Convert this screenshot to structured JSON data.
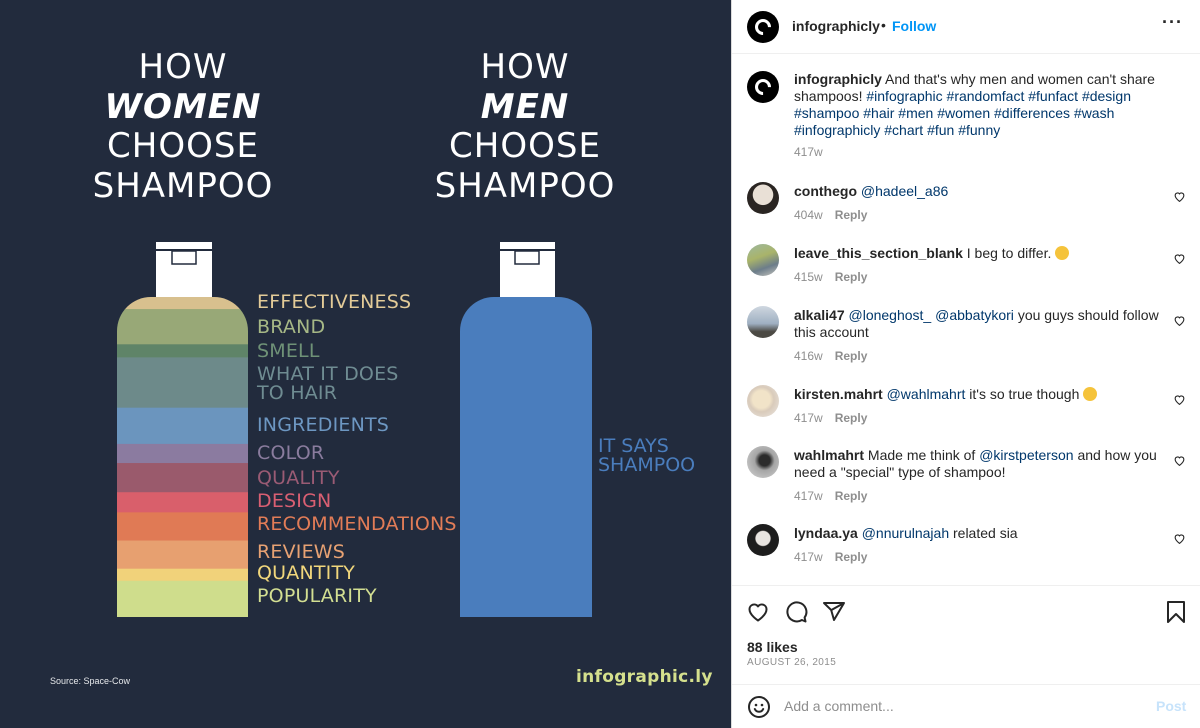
{
  "infographic": {
    "title_women": [
      "HOW",
      "WOMEN",
      "CHOOSE",
      "SHAMPOO"
    ],
    "title_men": [
      "HOW",
      "MEN",
      "CHOOSE",
      "SHAMPOO"
    ],
    "women_factors": [
      {
        "label": "EFFECTIVENESS",
        "color": "#d8c08e",
        "share": 12
      },
      {
        "label": "BRAND",
        "color": "#98a877",
        "share": 35
      },
      {
        "label": "SMELL",
        "color": "#5f8468",
        "share": 13
      },
      {
        "label": "WHAT IT DOES TO HAIR",
        "lines": [
          "WHAT IT DOES",
          "TO HAIR"
        ],
        "color": "#6d8a8a",
        "share": 50
      },
      {
        "label": "INGREDIENTS",
        "color": "#6b95be",
        "share": 36
      },
      {
        "label": "COLOR",
        "color": "#8b7ba0",
        "share": 19
      },
      {
        "label": "QUALITY",
        "color": "#9a5a6c",
        "share": 29
      },
      {
        "label": "DESIGN",
        "color": "#d95f6b",
        "share": 20
      },
      {
        "label": "RECOMMENDATIONS",
        "color": "#e07a55",
        "share": 28
      },
      {
        "label": "REVIEWS",
        "color": "#e7a070",
        "share": 28
      },
      {
        "label": "QUANTITY",
        "color": "#f1d27a",
        "share": 12
      },
      {
        "label": "POPULARITY",
        "color": "#cfdd8c",
        "share": 36
      }
    ],
    "label_colors": {
      "EFFECTIVENESS": "#e3cb98",
      "BRAND": "#a6b886",
      "SMELL": "#6f9277",
      "WHAT IT DOES TO HAIR": "#6f8c92",
      "INGREDIENTS": "#6d97c2",
      "COLOR": "#8a7c9e",
      "QUALITY": "#9a5b74",
      "DESIGN": "#d95f72",
      "RECOMMENDATIONS": "#e27c57",
      "REVIEWS": "#e8a273",
      "QUANTITY": "#f1d77c",
      "POPULARITY": "#d3df92"
    },
    "men_factor": {
      "label": "IT SAYS SHAMPOO",
      "lines": [
        "IT SAYS",
        "SHAMPOO"
      ],
      "color": "#4a7dbd",
      "share": 100
    },
    "source": "Source: Space-Cow",
    "brand": "infographic.ly"
  },
  "post": {
    "author": "infographicly",
    "separator": "•",
    "follow_label": "Follow",
    "more_icon": "more-horizontal-icon",
    "caption": {
      "user": "infographicly",
      "text": "And that's why men and women can't share shampoos!",
      "hashtags": "#infographic #randomfact #funfact #design #shampoo #hair #men #women #differences #wash #infographicly #chart #fun #funny",
      "age": "417w"
    },
    "comments": [
      {
        "user": "conthego",
        "mentions": "@hadeel_a86",
        "text": "",
        "age": "404w",
        "reply": "Reply"
      },
      {
        "user": "leave_this_section_blank",
        "mentions": "",
        "text": "I beg to differ.",
        "emoji": "😏",
        "age": "415w",
        "reply": "Reply"
      },
      {
        "user": "alkali47",
        "mentions": "@loneghost_ @abbatykori",
        "text": "you guys should follow this account",
        "age": "416w",
        "reply": "Reply"
      },
      {
        "user": "kirsten.mahrt",
        "mentions": "@wahlmahrt",
        "text": "it's so true though",
        "emoji": "😉",
        "age": "417w",
        "reply": "Reply"
      },
      {
        "user": "wahlmahrt",
        "pre": "Made me think of",
        "mentions": "@kirstpeterson",
        "text": "and how you need a \"special\" type of shampoo!",
        "age": "417w",
        "reply": "Reply"
      },
      {
        "user": "lyndaa.ya",
        "mentions": "@nnurulnajah",
        "text": "related sia",
        "age": "417w",
        "reply": "Reply"
      }
    ],
    "likes": "88 likes",
    "date": "AUGUST 26, 2015",
    "add_comment_placeholder": "Add a comment...",
    "post_label": "Post"
  }
}
